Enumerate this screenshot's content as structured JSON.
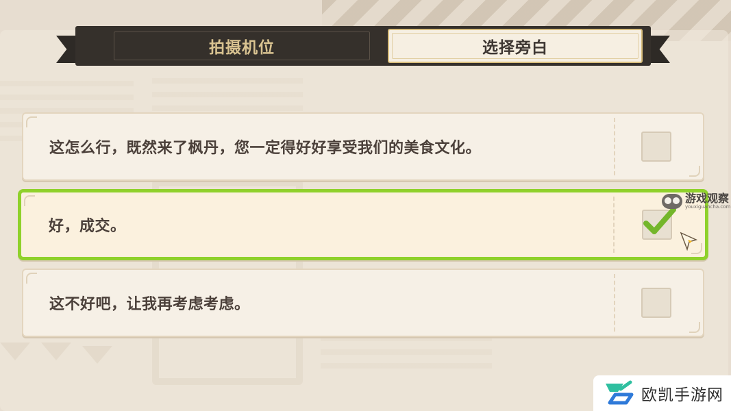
{
  "tabs": [
    {
      "label": "拍摄机位",
      "active": false
    },
    {
      "label": "选择旁白",
      "active": true
    }
  ],
  "options": [
    {
      "text": "这怎么行，既然来了枫丹，您一定得好好享受我们的美食文化。",
      "checked": false
    },
    {
      "text": "好，成交。",
      "checked": true
    },
    {
      "text": "这不好吧，让我再考虑考虑。",
      "checked": false
    }
  ],
  "watermarks": {
    "top": {
      "title": "游戏观察",
      "subtitle": "youxiguancha.com"
    },
    "bottom": {
      "name": "欧凯手游网"
    }
  },
  "colors": {
    "selected_border": "#8fd12b",
    "check_mark": "#74b62b",
    "tab_dark": "#35302b",
    "tab_inactive_text": "#d9c391",
    "text": "#4b403a"
  }
}
